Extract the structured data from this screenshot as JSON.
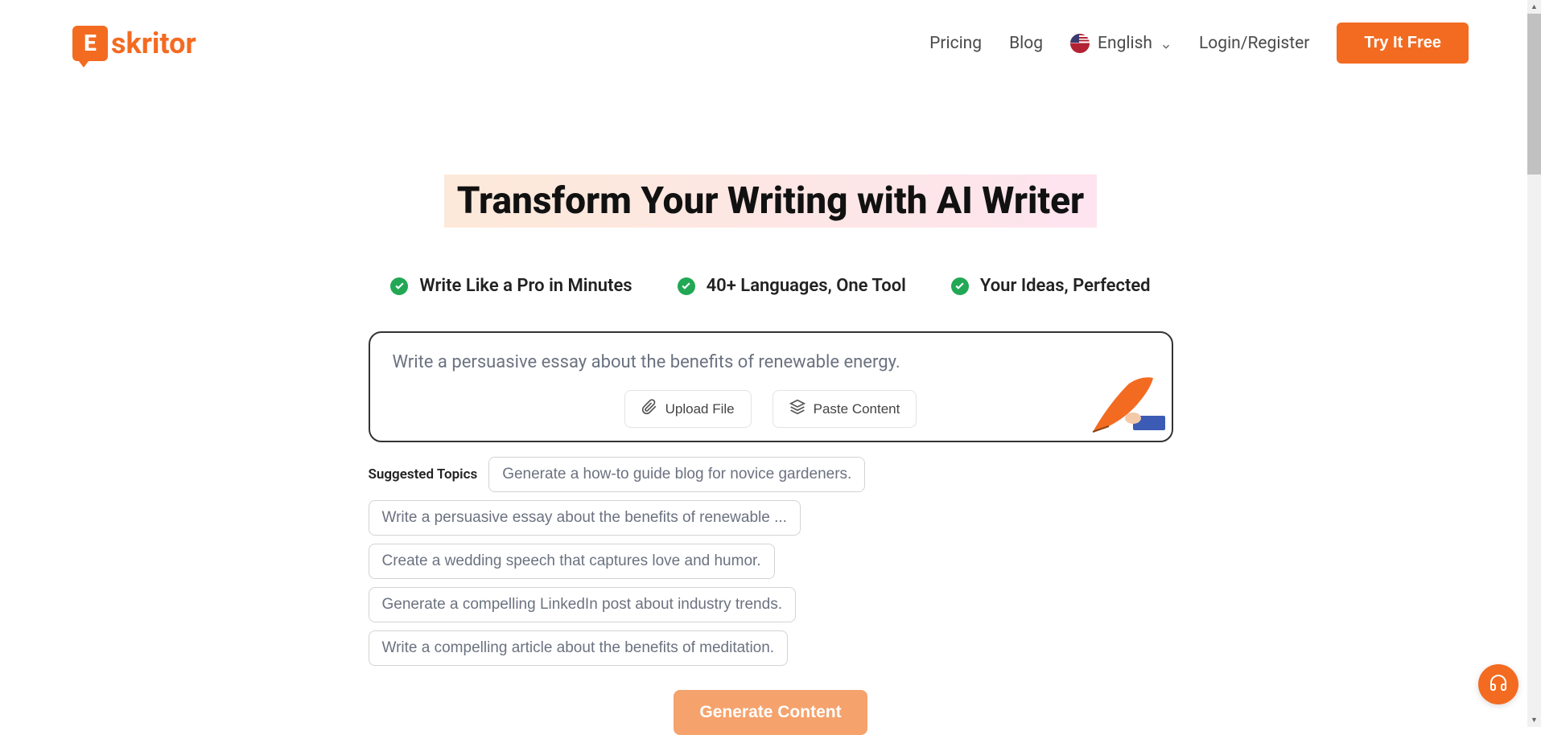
{
  "header": {
    "logo_text": "skritor",
    "logo_letter": "E",
    "nav": {
      "pricing": "Pricing",
      "blog": "Blog",
      "language": "English",
      "login": "Login/Register",
      "cta": "Try It Free"
    }
  },
  "hero": {
    "headline": "Transform Your Writing with AI Writer",
    "features": [
      "Write Like a Pro in Minutes",
      "40+ Languages, One Tool",
      "Your Ideas, Perfected"
    ],
    "prompt_placeholder": "Write a persuasive essay about the benefits of renewable energy.",
    "actions": {
      "upload": "Upload File",
      "paste": "Paste Content"
    },
    "suggested_label": "Suggested Topics",
    "suggested_topics": [
      "Generate a how-to guide blog for novice gardeners.",
      "Write a persuasive essay about the benefits of renewable ...",
      "Create a wedding speech that captures love and humor.",
      "Generate a compelling LinkedIn post about industry trends.",
      "Write a compelling article about the benefits of meditation."
    ],
    "generate_button": "Generate Content"
  },
  "colors": {
    "primary": "#F36B21",
    "success": "#22a855"
  }
}
